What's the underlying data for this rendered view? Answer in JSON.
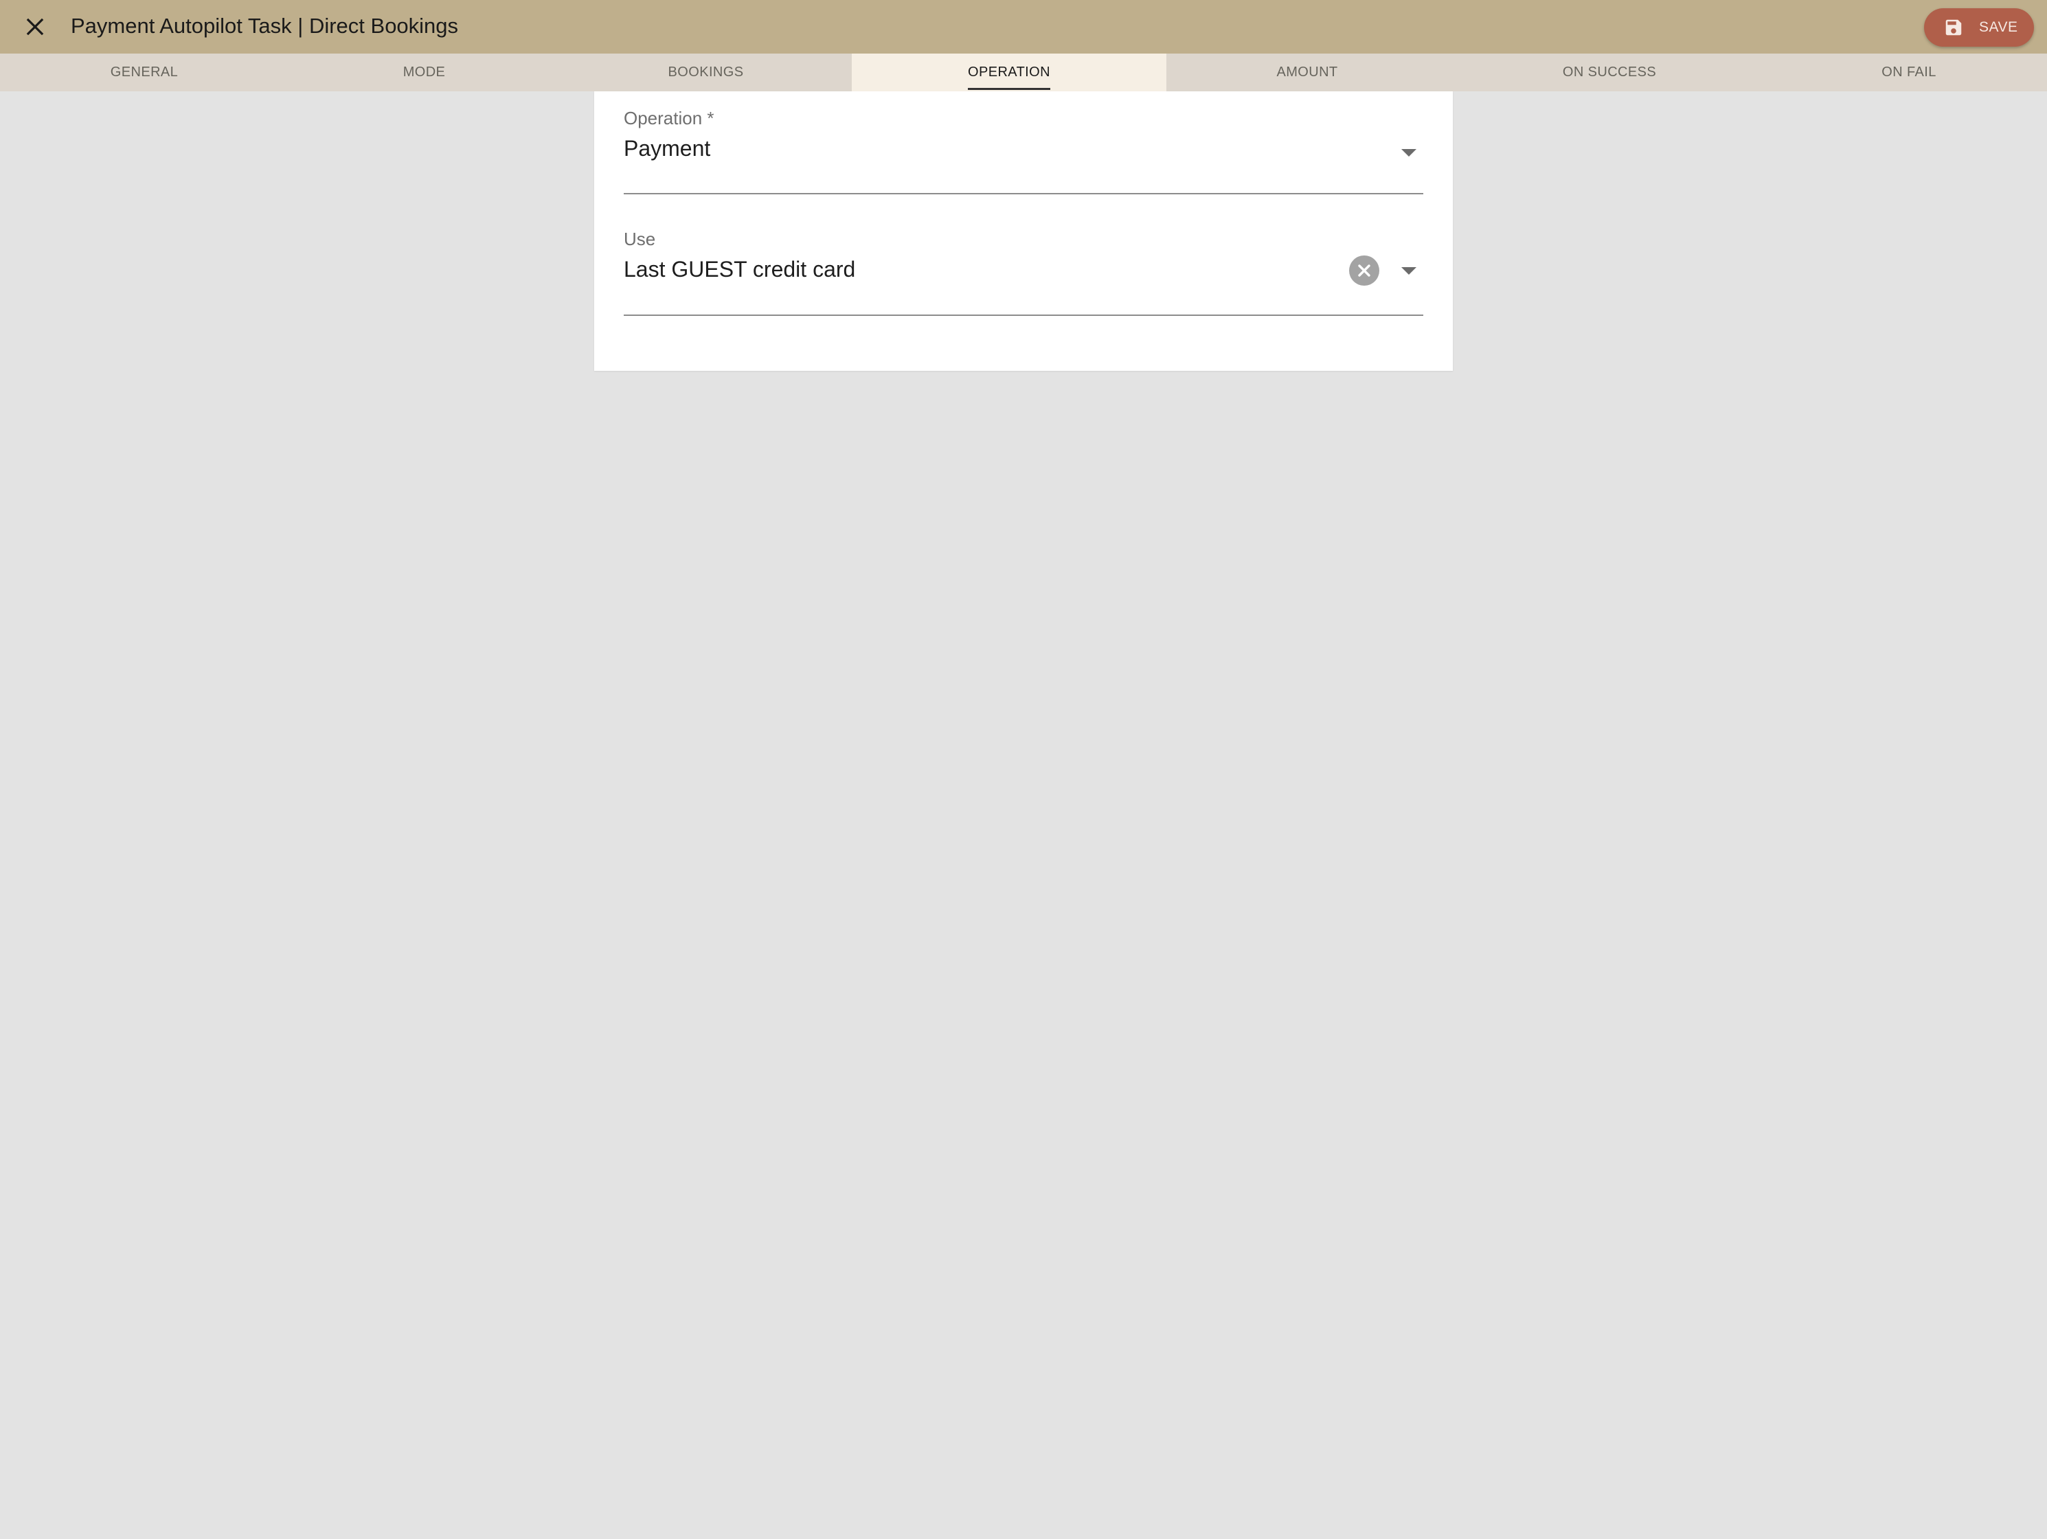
{
  "header": {
    "title": "Payment Autopilot Task | Direct Bookings",
    "save_label": "SAVE",
    "close_icon": "close-icon",
    "save_icon": "floppy-disk-icon",
    "background_color": "#bfaf8c",
    "save_color": "#b05f4a"
  },
  "tabs": [
    {
      "label": "GENERAL",
      "active": false
    },
    {
      "label": "MODE",
      "active": false
    },
    {
      "label": "BOOKINGS",
      "active": false
    },
    {
      "label": "OPERATION",
      "active": true
    },
    {
      "label": "AMOUNT",
      "active": false
    },
    {
      "label": "ON SUCCESS",
      "active": false
    },
    {
      "label": "ON FAIL",
      "active": false
    }
  ],
  "form": {
    "operation": {
      "label": "Operation *",
      "value": "Payment",
      "icon": "chevron-down-icon"
    },
    "use": {
      "label": "Use",
      "value": "Last GUEST credit card",
      "clear_icon": "clear-circle-icon",
      "icon": "chevron-down-icon"
    }
  }
}
